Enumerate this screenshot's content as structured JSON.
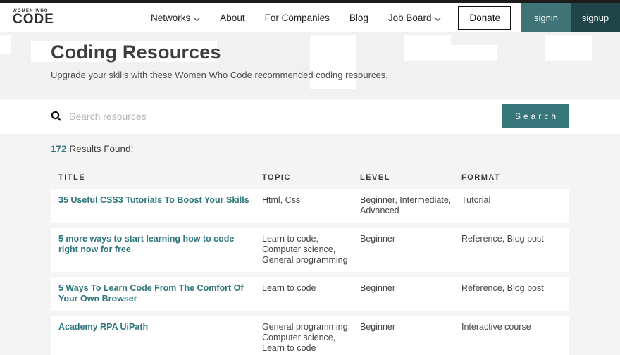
{
  "colors": {
    "accent_teal": "#2d767b",
    "signin_bg": "#3e7477",
    "signup_bg": "#1f4549",
    "search_button_bg": "#37777b",
    "topbar": "#1c1c1c"
  },
  "navbar": {
    "logo_top": "WOMEN WHO",
    "logo_main": "CODE",
    "items": [
      {
        "label": "Networks",
        "has_dropdown": true
      },
      {
        "label": "About",
        "has_dropdown": false
      },
      {
        "label": "For Companies",
        "has_dropdown": false
      },
      {
        "label": "Blog",
        "has_dropdown": false
      },
      {
        "label": "Job Board",
        "has_dropdown": true
      }
    ],
    "donate_label": "Donate",
    "signin_label": "signin",
    "signup_label": "signup"
  },
  "hero": {
    "title": "Coding Resources",
    "subtitle": "Upgrade your skills with these Women Who Code recommended coding resources."
  },
  "search": {
    "placeholder": "Search resources",
    "button_label": "Search"
  },
  "results": {
    "count": "172",
    "label": "Results Found!"
  },
  "table": {
    "headers": {
      "title": "TITLE",
      "topic": "TOPIC",
      "level": "LEVEL",
      "format": "FORMAT"
    },
    "rows": [
      {
        "title": "35 Useful CSS3 Tutorials To Boost Your Skills",
        "topic": "Html, Css",
        "level": "Beginner, Intermediate, Advanced",
        "format": "Tutorial"
      },
      {
        "title": "5 more ways to start learning how to code right now for free",
        "topic": "Learn to code, Computer science, General programming",
        "level": "Beginner",
        "format": "Reference, Blog post"
      },
      {
        "title": "5 Ways To Learn Code From The Comfort Of Your Own Browser",
        "topic": "Learn to code",
        "level": "Beginner",
        "format": "Reference, Blog post"
      },
      {
        "title": "Academy RPA UiPath",
        "topic": "General programming, Computer science, Learn to code",
        "level": "Beginner",
        "format": "Interactive course"
      }
    ]
  }
}
